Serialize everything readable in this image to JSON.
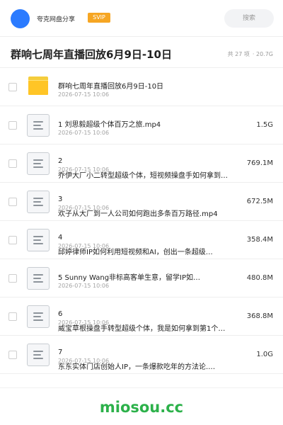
{
  "header": {
    "brand": "夸克网盘分享",
    "badge": "SVIP",
    "search_placeholder": "搜索",
    "accent_color": "#2b7bff",
    "badge_color": "#f6a623"
  },
  "title_bar": {
    "title": "群响七周年直播回放6月9日-10日",
    "count_text": "共 27 项",
    "size_text": "· 20.7G"
  },
  "files": [
    {
      "icon": "folder-icon",
      "name": "群响七周年直播回放6月9日-10日",
      "date": "2026-07-15 10:06",
      "size": ""
    },
    {
      "icon": "document-icon",
      "name": "1 刘思毅超级个体百万之旅.mp4",
      "date": "2026-07-15 10:06",
      "size": "1.5G"
    },
    {
      "icon": "document-icon",
      "name_line1": "2",
      "name": "乔伊大厂小二转型超级个体，短视频操盘手如何拿到…",
      "date": "2026-07-15 10:06",
      "size": "769.1M"
    },
    {
      "icon": "document-icon",
      "name_line1": "3",
      "name": "欢子从大厂到一人公司如何跑出多条百万路径.mp4",
      "date": "2026-07-15 10:06",
      "size": "672.5M"
    },
    {
      "icon": "document-icon",
      "name_line1": "4",
      "name": "邱婷律师IP如何利用短视频和AI，创出一条超级…",
      "date": "2026-07-15 10:06",
      "size": "358.4M"
    },
    {
      "icon": "document-icon",
      "name": "5 Sunny Wang非标高客单生意，留学IP如…",
      "date": "2026-07-15 10:06",
      "size": "480.8M"
    },
    {
      "icon": "document-icon",
      "name_line1": "6",
      "name": "威宝草根操盘手转型超级个体，我是如何拿到第1个…",
      "date": "2026-07-15 10:06",
      "size": "368.8M"
    },
    {
      "icon": "document-icon",
      "name_line1": "7",
      "name": "东东实体门店创始人IP，一条爆款吃年的方法论.…",
      "date": "2026-07-15 10:06",
      "size": "1.0G"
    }
  ],
  "watermark": "miosou.cc"
}
